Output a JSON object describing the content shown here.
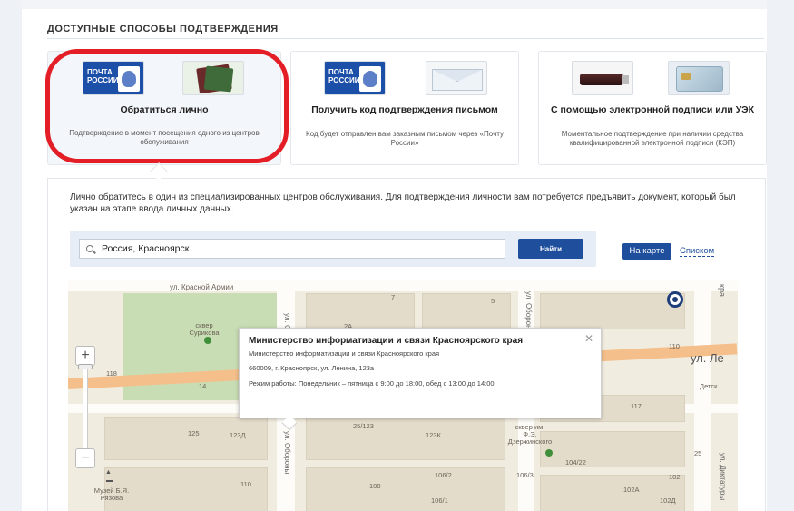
{
  "section": {
    "heading": "ДОСТУПНЫЕ СПОСОБЫ ПОДТВЕРЖДЕНИЯ"
  },
  "methods": [
    {
      "logo_text": "ПОЧТА РОССИИ",
      "title": "Обратиться лично",
      "description": "Подтверждение в момент посещения одного из центров обслуживания"
    },
    {
      "logo_text": "ПОЧТА РОССИИ",
      "title": "Получить код подтверждения письмом",
      "description": "Код будет отправлен вам заказным письмом через «Почту России»"
    },
    {
      "title": "С помощью электронной подписи или УЭК",
      "description": "Моментальное подтверждение при наличии средства квалифицированной электронной подписи (КЭП)"
    }
  ],
  "content": {
    "intro": "Лично обратитесь в один из специализированных центров обслуживания. Для подтверждения личности вам потребуется предъявить документ, который был указан на этапе ввода личных данных."
  },
  "search": {
    "value": "Россия, Красноярск",
    "button": "Найти"
  },
  "view": {
    "map": "На карте",
    "list": "Списком"
  },
  "map": {
    "labels": {
      "street_red_army": "ул. Красной Армии",
      "square_surikov": "сквер Сурикова",
      "street_oborony": "ул. Обороны",
      "street_lenina": "ул. Ле",
      "square_dzerzhinsky": "сквер им. Ф.Э. Дзержинского",
      "museum": "Музей Б.Я. Рязова",
      "street_dikt": "ул. Диктатуры",
      "detsk": "Детск",
      "kra": "кра",
      "n7": "7",
      "n5": "5",
      "n2a": "2А",
      "n110": "110",
      "n118": "118",
      "n117": "117",
      "n125": "125",
      "n123d": "123Д",
      "n25123": "25/123",
      "n123k": "123К",
      "n10422": "104/22",
      "n25": "25",
      "n102": "102",
      "n102a": "102А",
      "n102d": "102Д",
      "n110b": "110",
      "n108": "108",
      "n1062": "106/2",
      "n1063": "106/3",
      "n1061": "106/1",
      "n14": "14"
    },
    "popup": {
      "title": "Министерство информатизации и связи Красноярского края",
      "subtitle": "Министерство информатизации и связи Красноярского края",
      "address": "660009, г. Красноярск, ул. Ленина, 123а",
      "hours": "Режим работы: Понедельник – пятница с 9:00 до 18:00, обед с 13:00 до 14:00"
    }
  }
}
